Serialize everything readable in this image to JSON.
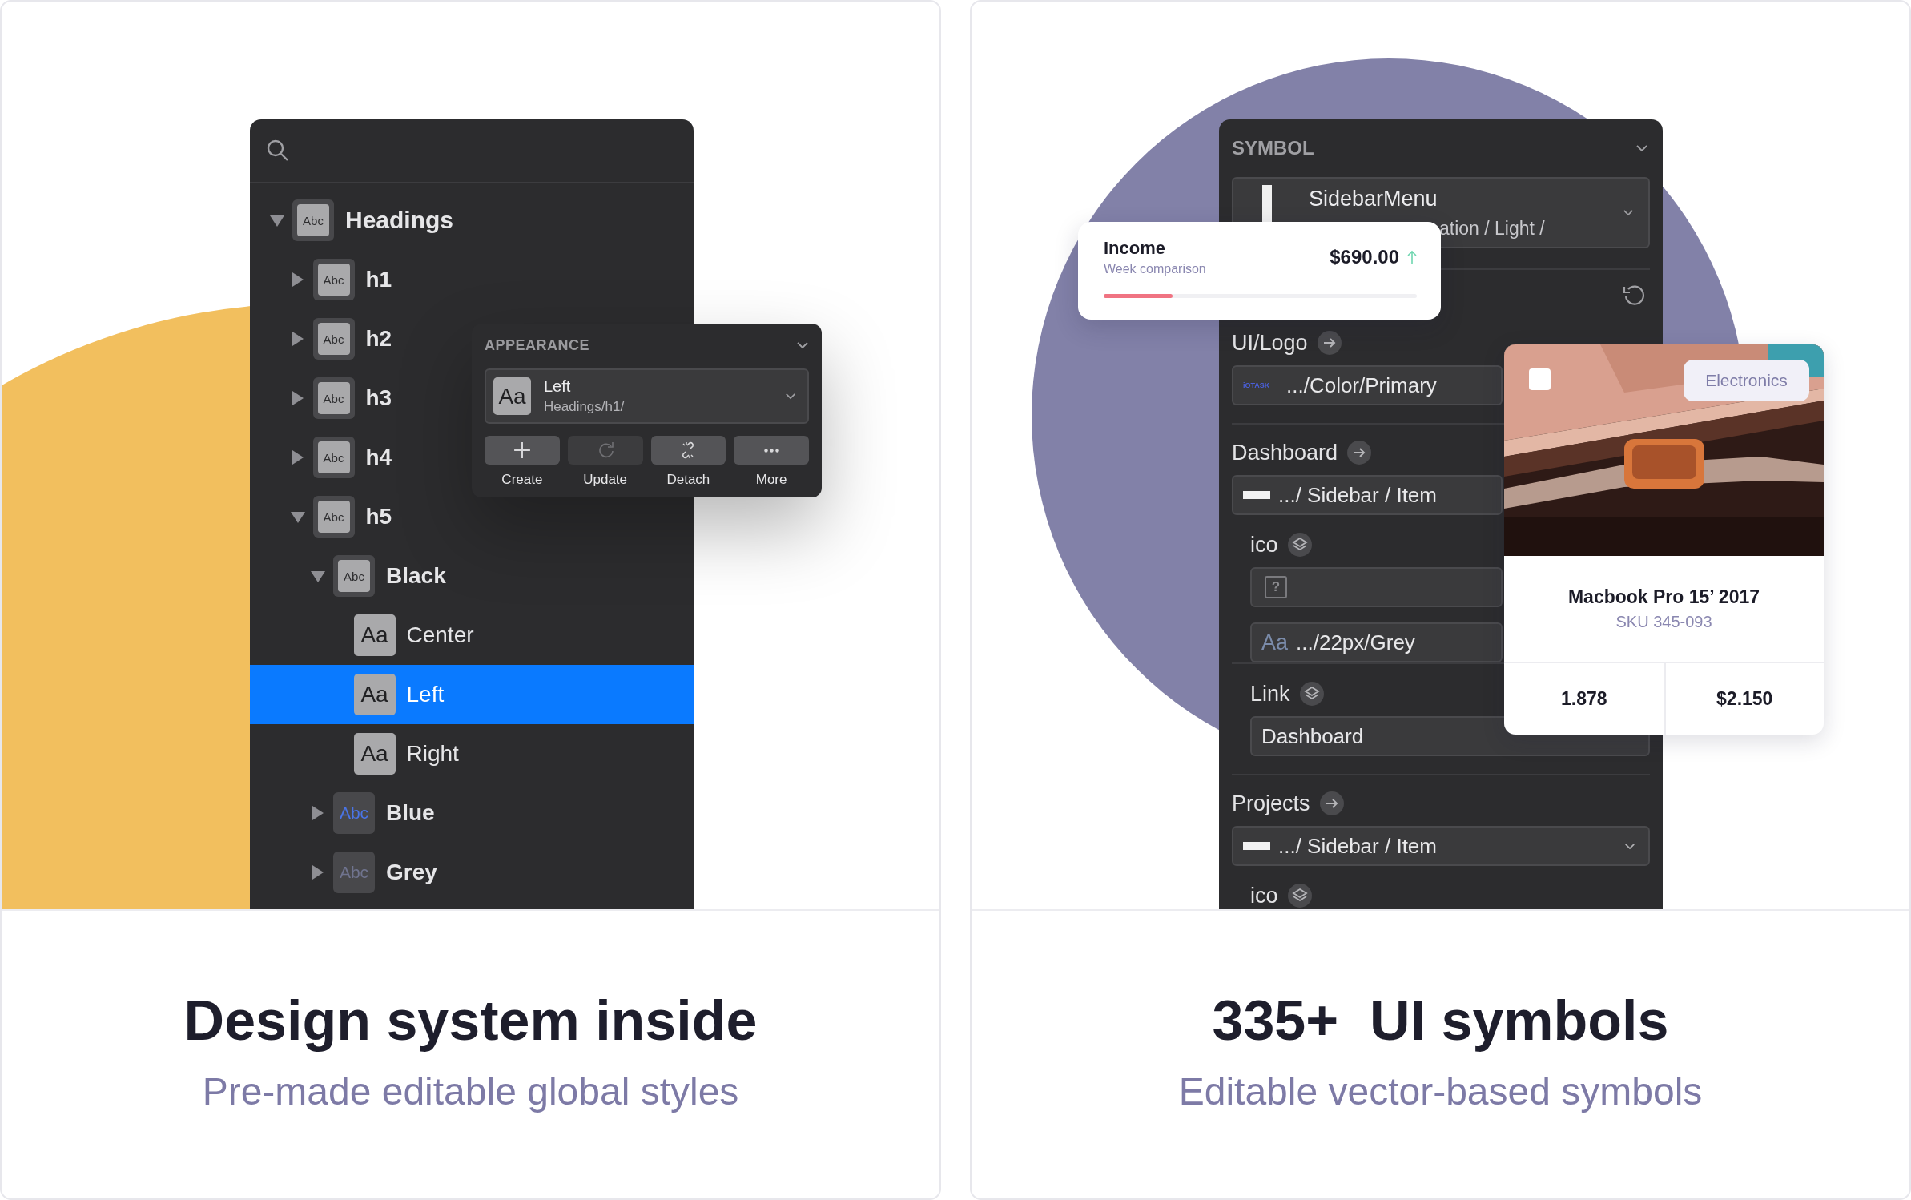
{
  "left_card": {
    "tree": [
      {
        "label": "Headings",
        "kind": "group",
        "thumb": "Abc",
        "expanded": true,
        "selected": false,
        "children": [
          {
            "label": "h1",
            "kind": "group",
            "thumb": "Abc",
            "expanded": false,
            "selected": false
          },
          {
            "label": "h2",
            "kind": "group",
            "thumb": "Abc",
            "expanded": false,
            "selected": false
          },
          {
            "label": "h3",
            "kind": "group",
            "thumb": "Abc",
            "expanded": false,
            "selected": false
          },
          {
            "label": "h4",
            "kind": "group",
            "thumb": "Abc",
            "expanded": false,
            "selected": false
          },
          {
            "label": "h5",
            "kind": "group",
            "thumb": "Abc",
            "expanded": true,
            "selected": false,
            "children": [
              {
                "label": "Black",
                "kind": "group",
                "thumb": "Abc",
                "expanded": true,
                "selected": false,
                "children": [
                  {
                    "label": "Center",
                    "kind": "style",
                    "thumb": "Aa",
                    "selected": false
                  },
                  {
                    "label": "Left",
                    "kind": "style",
                    "thumb": "Aa",
                    "selected": true
                  },
                  {
                    "label": "Right",
                    "kind": "style",
                    "thumb": "Aa",
                    "selected": false
                  }
                ]
              },
              {
                "label": "Blue",
                "kind": "group",
                "thumb": "Abc",
                "color": "#4a74e6",
                "expanded": false,
                "selected": false
              },
              {
                "label": "Grey",
                "kind": "group",
                "thumb": "Abc",
                "color": "#70748f",
                "expanded": false,
                "selected": false
              }
            ]
          }
        ]
      }
    ],
    "popup": {
      "title": "APPEARANCE",
      "style": {
        "thumb": "Aa",
        "name": "Left",
        "path": "Headings/h1/"
      },
      "actions": [
        {
          "label": "Create",
          "disabled": false
        },
        {
          "label": "Update",
          "disabled": true
        },
        {
          "label": "Detach",
          "disabled": false
        },
        {
          "label": "More",
          "disabled": false
        }
      ]
    },
    "heading": "Design system inside",
    "subheading": "Pre-made editable global styles"
  },
  "right_card": {
    "symbol_panel": {
      "title": "SYMBOL",
      "symbol": {
        "name": "SidebarMenu",
        "path": "ation / Light /"
      },
      "overrides": [
        {
          "label": "UI/Logo",
          "kind": "arrow",
          "fields": [
            {
              "kind": "logo",
              "thumb_text": "iOTASK",
              "value": ".../Color/Primary"
            }
          ]
        },
        {
          "label": "Dashboard",
          "kind": "arrow",
          "fields": [
            {
              "kind": "bar",
              "value": ".../ Sidebar / Item"
            }
          ],
          "children": [
            {
              "label": "ico",
              "kind": "layers",
              "fields": [
                {
                  "kind": "missing",
                  "thumb_text": "?"
                },
                {
                  "kind": "text",
                  "thumb_text": "Aa",
                  "value": ".../22px/Grey"
                }
              ]
            },
            {
              "label": "Link",
              "kind": "layers",
              "fields": [
                {
                  "kind": "plain",
                  "value": "Dashboard"
                }
              ]
            }
          ]
        },
        {
          "label": "Projects",
          "kind": "arrow",
          "fields": [
            {
              "kind": "bar",
              "value": ".../ Sidebar / Item",
              "dropdown": true
            }
          ],
          "children": [
            {
              "label": "ico",
              "kind": "layers"
            }
          ]
        }
      ]
    },
    "income_card": {
      "title": "Income",
      "subtitle": "Week comparison",
      "amount": "$690.00",
      "trend_up": true,
      "level": 0.22
    },
    "product_card": {
      "checked": false,
      "badge": "Electronics",
      "title": "Macbook Pro 15’ 2017",
      "sku": "SKU 345-093",
      "stats": [
        "1.878",
        "$2.150"
      ]
    },
    "heading": "335+  UI symbols",
    "subheading": "Editable vector-based symbols"
  }
}
